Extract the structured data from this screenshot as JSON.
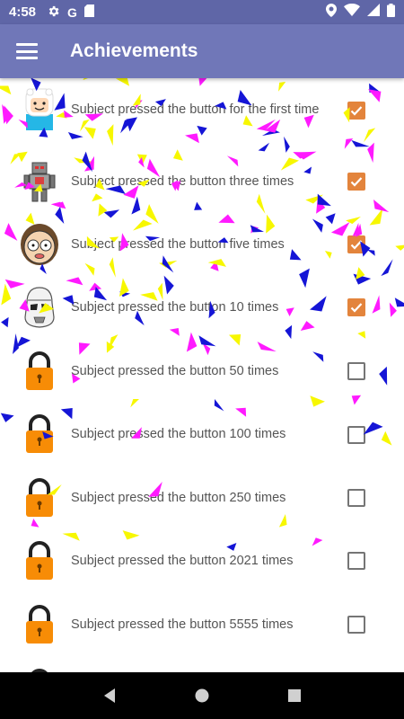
{
  "status_bar": {
    "time": "4:58",
    "left_icons": [
      "gear-icon",
      "google-icon",
      "sd-card-icon"
    ],
    "google_letter": "G",
    "right_icons": [
      "location-icon",
      "wifi-icon",
      "signal-icon",
      "battery-icon"
    ]
  },
  "app_bar": {
    "title": "Achievements",
    "menu_icon": "hamburger-menu-icon"
  },
  "achievements": [
    {
      "label": "Subject pressed the button for the first time",
      "icon": "finn-avatar-icon",
      "checked": true
    },
    {
      "label": "Subject pressed the button three times",
      "icon": "robot-avatar-icon",
      "checked": true
    },
    {
      "label": "Subject pressed the button five times",
      "icon": "morty-avatar-icon",
      "checked": true
    },
    {
      "label": "Subject pressed the button 10 times",
      "icon": "stormtrooper-avatar-icon",
      "checked": true
    },
    {
      "label": "Subject pressed the button 50 times",
      "icon": "lock-icon",
      "checked": false
    },
    {
      "label": "Subject pressed the button 100 times",
      "icon": "lock-icon",
      "checked": false
    },
    {
      "label": "Subject pressed the button 250 times",
      "icon": "lock-icon",
      "checked": false
    },
    {
      "label": "Subject pressed the button 2021 times",
      "icon": "lock-icon",
      "checked": false
    },
    {
      "label": "Subject pressed the button 5555 times",
      "icon": "lock-icon",
      "checked": false
    }
  ],
  "colors": {
    "status_bar": "#5f66a7",
    "app_bar": "#7077b8",
    "checkbox_checked": "#e3843c",
    "lock": "#f78c06",
    "confetti": [
      "#1515d6",
      "#ff1aff",
      "#f7f700"
    ]
  },
  "nav_bar": {
    "icons": [
      "back-icon",
      "home-icon",
      "recents-icon"
    ]
  }
}
